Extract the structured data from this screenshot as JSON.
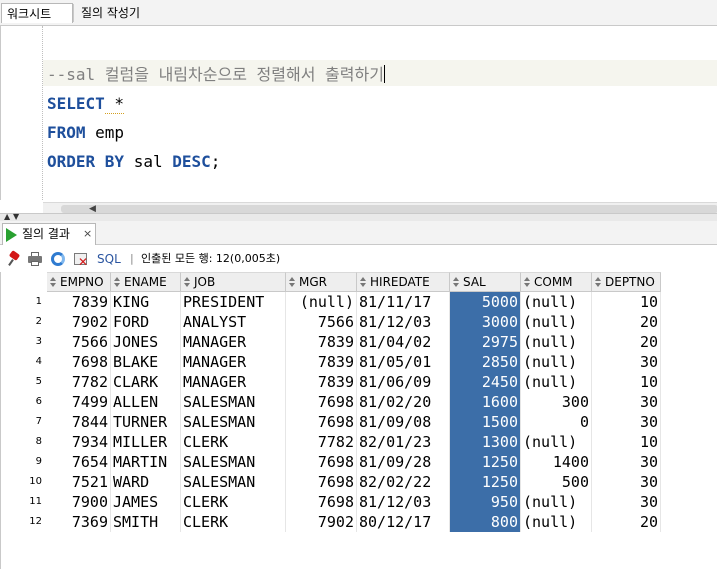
{
  "tabs": {
    "worksheet": "워크시트",
    "query_builder": "질의 작성기"
  },
  "editor": {
    "comment": "--sal 컬럼을 내림차순으로 정렬해서 출력하기",
    "kw_select": "SELECT",
    "select_rest": " *",
    "kw_from": "FROM",
    "from_rest": " emp",
    "kw_order_by": "ORDER BY",
    "order_mid": " sal ",
    "kw_desc": "DESC",
    "order_end": ";"
  },
  "results": {
    "tab_label": "질의 결과",
    "close_glyph": "×",
    "sql_label": "SQL",
    "separator": "|",
    "status": "인출된 모든 행: 12(0,005초)"
  },
  "grid": {
    "columns": [
      "EMPNO",
      "ENAME",
      "JOB",
      "MGR",
      "HIREDATE",
      "SAL",
      "COMM",
      "DEPTNO"
    ],
    "rows": [
      [
        "1",
        "7839",
        "KING",
        "PRESIDENT",
        "(null)",
        "81/11/17",
        "5000",
        "(null)",
        "10"
      ],
      [
        "2",
        "7902",
        "FORD",
        "ANALYST",
        "7566",
        "81/12/03",
        "3000",
        "(null)",
        "20"
      ],
      [
        "3",
        "7566",
        "JONES",
        "MANAGER",
        "7839",
        "81/04/02",
        "2975",
        "(null)",
        "20"
      ],
      [
        "4",
        "7698",
        "BLAKE",
        "MANAGER",
        "7839",
        "81/05/01",
        "2850",
        "(null)",
        "30"
      ],
      [
        "5",
        "7782",
        "CLARK",
        "MANAGER",
        "7839",
        "81/06/09",
        "2450",
        "(null)",
        "10"
      ],
      [
        "6",
        "7499",
        "ALLEN",
        "SALESMAN",
        "7698",
        "81/02/20",
        "1600",
        "300",
        "30"
      ],
      [
        "7",
        "7844",
        "TURNER",
        "SALESMAN",
        "7698",
        "81/09/08",
        "1500",
        "0",
        "30"
      ],
      [
        "8",
        "7934",
        "MILLER",
        "CLERK",
        "7782",
        "82/01/23",
        "1300",
        "(null)",
        "10"
      ],
      [
        "9",
        "7654",
        "MARTIN",
        "SALESMAN",
        "7698",
        "81/09/28",
        "1250",
        "1400",
        "30"
      ],
      [
        "10",
        "7521",
        "WARD",
        "SALESMAN",
        "7698",
        "82/02/22",
        "1250",
        "500",
        "30"
      ],
      [
        "11",
        "7900",
        "JAMES",
        "CLERK",
        "7698",
        "81/12/03",
        "950",
        "(null)",
        "30"
      ],
      [
        "12",
        "7369",
        "SMITH",
        "CLERK",
        "7902",
        "80/12/17",
        "800",
        "(null)",
        "20"
      ]
    ],
    "selected_column": "SAL"
  },
  "colors": {
    "keyword": "#1e4f9c",
    "comment": "#808080",
    "selection": "#3c6ea8",
    "run_icon": "#28a030",
    "pin_icon": "#d21818"
  },
  "icons": [
    "pin-icon",
    "print-icon",
    "refresh-icon",
    "delete-icon",
    "run-icon",
    "sort-icon"
  ]
}
